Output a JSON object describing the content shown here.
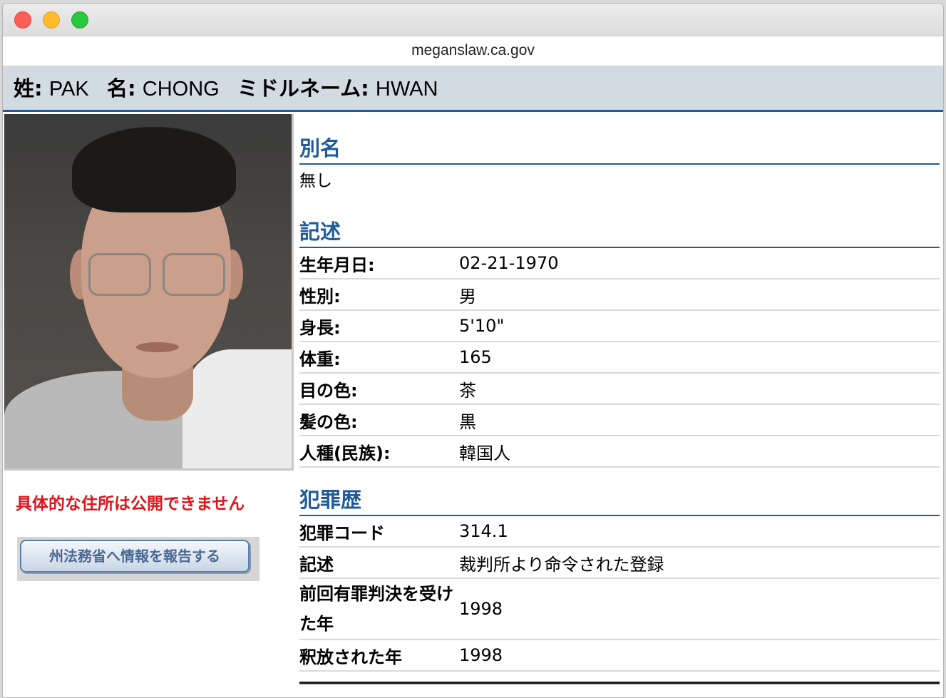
{
  "window": {
    "url": "meganslaw.ca.gov"
  },
  "name": {
    "last_label": "姓:",
    "last_value": "PAK",
    "first_label": "名:",
    "first_value": "CHONG",
    "middle_label": "ミドルネーム:",
    "middle_value": "HWAN"
  },
  "warning": "具体的な住所は公開できません",
  "report_button": "州法務省へ情報を報告する",
  "aliases": {
    "title": "別名",
    "value": "無し"
  },
  "description": {
    "title": "記述",
    "rows": [
      {
        "label": "生年月日:",
        "value": "02-21-1970"
      },
      {
        "label": "性別:",
        "value": "男"
      },
      {
        "label": "身長:",
        "value": "5'10\""
      },
      {
        "label": "体重:",
        "value": "165"
      },
      {
        "label": "目の色:",
        "value": "茶"
      },
      {
        "label": "髪の色:",
        "value": "黒"
      },
      {
        "label": "人種(民族):",
        "value": "韓国人"
      }
    ]
  },
  "offenses": {
    "title": "犯罪歴",
    "rows": [
      {
        "label": "犯罪コード",
        "value": "314.1"
      },
      {
        "label": "記述",
        "value": "裁判所より命令された登録"
      },
      {
        "label": "前回有罪判決を受けた年",
        "value": "1998"
      },
      {
        "label": "釈放された年",
        "value": "1998"
      }
    ]
  }
}
